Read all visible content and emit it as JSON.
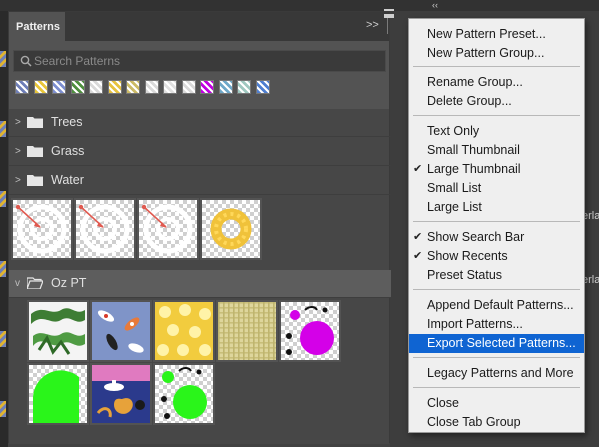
{
  "topbar": {
    "collapse_icon": "double-chevron-left"
  },
  "panel": {
    "tab_label": "Patterns",
    "expand_icon": "double-chevron-right",
    "menu_icon": "hamburger",
    "search": {
      "placeholder": "Search Patterns",
      "value": ""
    },
    "recents": [
      {
        "icon": "pattern-swatch",
        "color": "#6f7fb8"
      },
      {
        "icon": "pattern-swatch",
        "color": "#e8c63a"
      },
      {
        "icon": "pattern-swatch",
        "color": "#7d8fd0"
      },
      {
        "icon": "pattern-swatch",
        "color": "#4f8f3f"
      },
      {
        "icon": "pattern-swatch",
        "color": "#d9d9d9"
      },
      {
        "icon": "pattern-swatch",
        "color": "#e6c240"
      },
      {
        "icon": "pattern-swatch",
        "color": "#ccbb66"
      },
      {
        "icon": "pattern-swatch",
        "color": "#d9d9d9"
      },
      {
        "icon": "pattern-swatch",
        "color": "#e0e0e0"
      },
      {
        "icon": "pattern-swatch",
        "color": "#d9d9d9"
      },
      {
        "icon": "pattern-swatch",
        "color": "#c000e0"
      },
      {
        "icon": "pattern-swatch",
        "color": "#6fa8c8"
      },
      {
        "icon": "pattern-swatch",
        "color": "#9fc8c0"
      },
      {
        "icon": "pattern-swatch",
        "color": "#4f7fd0"
      }
    ],
    "groups": [
      {
        "label": "Trees",
        "expanded": false
      },
      {
        "label": "Grass",
        "expanded": false
      },
      {
        "label": "Water",
        "expanded": false
      },
      {
        "label": "Oz PT",
        "expanded": true
      }
    ]
  },
  "menu": {
    "items": [
      {
        "label": "New Pattern Preset...",
        "checked": false
      },
      {
        "label": "New Pattern Group...",
        "checked": false
      },
      {
        "label": "Rename Group...",
        "checked": false
      },
      {
        "label": "Delete Group...",
        "checked": false
      },
      {
        "label": "Text Only",
        "checked": false
      },
      {
        "label": "Small Thumbnail",
        "checked": false
      },
      {
        "label": "Large Thumbnail",
        "checked": true
      },
      {
        "label": "Small List",
        "checked": false
      },
      {
        "label": "Large List",
        "checked": false
      },
      {
        "label": "Show Search Bar",
        "checked": true
      },
      {
        "label": "Show Recents",
        "checked": true
      },
      {
        "label": "Preset Status",
        "checked": false
      },
      {
        "label": "Append Default Patterns...",
        "checked": false
      },
      {
        "label": "Import Patterns...",
        "checked": false
      },
      {
        "label": "Export Selected Patterns...",
        "checked": false,
        "highlighted": true
      },
      {
        "label": "Legacy Patterns and More",
        "checked": false
      },
      {
        "label": "Close",
        "checked": false
      },
      {
        "label": "Close Tab Group",
        "checked": false
      }
    ],
    "check_glyph": "✔"
  },
  "background_panel": {
    "partial_label": "erlar"
  },
  "colors": {
    "accent": "#0f64d2",
    "panel_bg": "#535353",
    "magenta": "#d400e8",
    "green": "#2af51a"
  }
}
